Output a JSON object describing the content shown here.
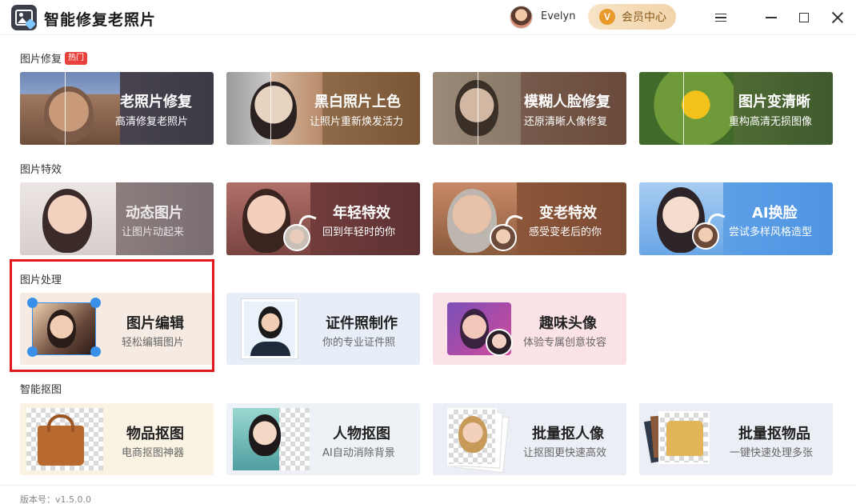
{
  "app": {
    "title": "智能修复老照片"
  },
  "user": {
    "name": "Evelyn"
  },
  "vip": {
    "icon_letter": "V",
    "label": "会员中心"
  },
  "sections": [
    {
      "label": "图片修复",
      "badge": "热门",
      "cards": [
        {
          "title": "老照片修复",
          "subtitle": "高清修复老照片"
        },
        {
          "title": "黑白照片上色",
          "subtitle": "让照片重新焕发活力"
        },
        {
          "title": "模糊人脸修复",
          "subtitle": "还原清晰人像修复"
        },
        {
          "title": "图片变清晰",
          "subtitle": "重构高清无损图像"
        }
      ]
    },
    {
      "label": "图片特效",
      "cards": [
        {
          "title": "动态图片",
          "subtitle": "让图片动起来"
        },
        {
          "title": "年轻特效",
          "subtitle": "回到年轻时的你"
        },
        {
          "title": "变老特效",
          "subtitle": "感受变老后的你"
        },
        {
          "title": "AI换脸",
          "subtitle": "尝试多样风格造型"
        }
      ]
    },
    {
      "label": "图片处理",
      "cards": [
        {
          "title": "图片编辑",
          "subtitle": "轻松编辑图片"
        },
        {
          "title": "证件照制作",
          "subtitle": "你的专业证件照"
        },
        {
          "title": "趣味头像",
          "subtitle": "体验专属创意妆容"
        }
      ]
    },
    {
      "label": "智能抠图",
      "cards": [
        {
          "title": "物品抠图",
          "subtitle": "电商抠图神器"
        },
        {
          "title": "人物抠图",
          "subtitle": "AI自动消除背景"
        },
        {
          "title": "批量抠人像",
          "subtitle": "让抠图更快速高效"
        },
        {
          "title": "批量抠物品",
          "subtitle": "一键快速处理多张"
        }
      ]
    }
  ],
  "footer": {
    "version": "版本号：v1.5.0.0"
  },
  "colors": {
    "highlight_border": "#e0191c",
    "hot_badge": "#e8413b",
    "vip_bg": "#f1d4aa",
    "ai_swap_card": "#4f9de8"
  },
  "icons": [
    "app-logo-icon",
    "menu-icon",
    "minimize-icon",
    "maximize-icon",
    "close-icon",
    "vip-icon"
  ]
}
